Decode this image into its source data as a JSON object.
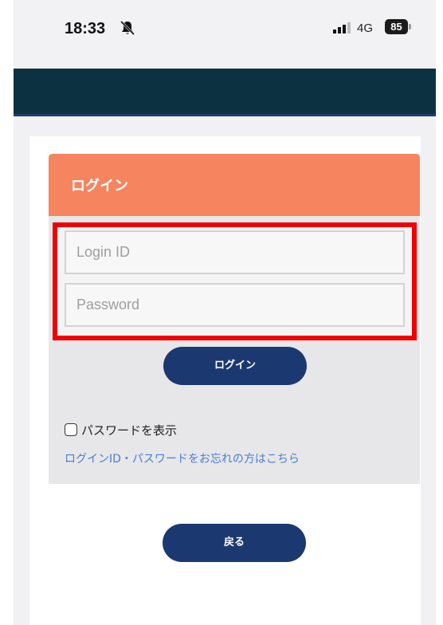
{
  "status_bar": {
    "time": "18:33",
    "network": "4G",
    "battery": "85"
  },
  "login": {
    "title": "ログイン",
    "login_id_placeholder": "Login ID",
    "password_placeholder": "Password",
    "submit_label": "ログイン",
    "show_password_label": "パスワードを表示",
    "forgot_link": "ログインID・パスワードをお忘れの方はこちら"
  },
  "back_button_label": "戻る",
  "colors": {
    "header_band": "#0c3241",
    "login_header": "#f5845f",
    "button": "#1b3970",
    "highlight": "#f00000",
    "link": "#4a7fd0"
  }
}
